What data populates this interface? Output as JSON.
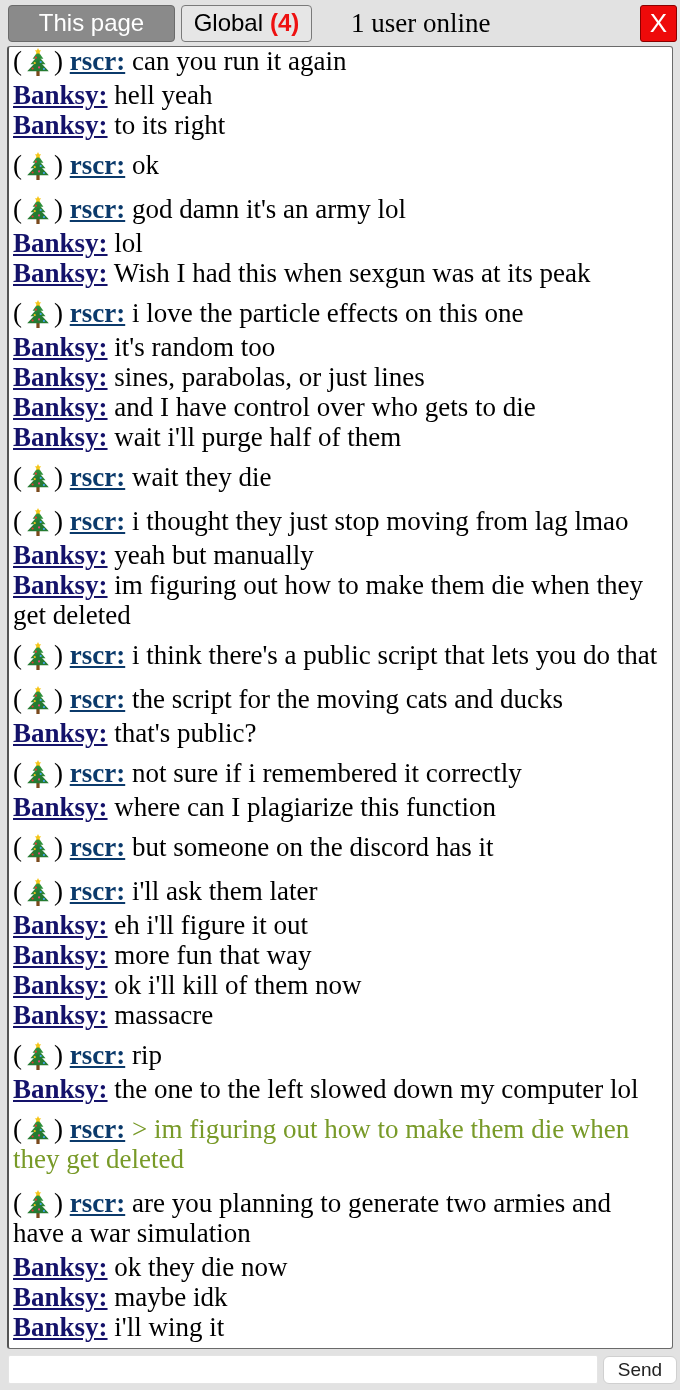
{
  "tabs": [
    {
      "label": "This page",
      "selected": true
    },
    {
      "label": "Global",
      "count": "(4)",
      "selected": false
    }
  ],
  "online_status": "1 user online",
  "close_button": "X",
  "messages": [
    {
      "badge": {
        "open": "(",
        "close": ")"
      },
      "user": "rscr:",
      "color": "#0b3a6b",
      "kind": "text",
      "text": "can you run it again"
    },
    {
      "user": "Banksy:",
      "color": "#14126a",
      "kind": "text",
      "text": "hell yeah"
    },
    {
      "user": "Banksy:",
      "color": "#14126a",
      "kind": "text",
      "text": "to its right"
    },
    {
      "badge": {
        "open": "(",
        "close": ")"
      },
      "user": "rscr:",
      "color": "#0b3a6b",
      "kind": "text",
      "text": "ok"
    },
    {
      "badge": {
        "open": "(",
        "close": ")"
      },
      "user": "rscr:",
      "color": "#0b3a6b",
      "kind": "text",
      "text": "god damn it's an army lol"
    },
    {
      "user": "Banksy:",
      "color": "#14126a",
      "kind": "text",
      "text": "lol"
    },
    {
      "user": "Banksy:",
      "color": "#14126a",
      "kind": "text",
      "text": "Wish I had this when sexgun was at its peak"
    },
    {
      "badge": {
        "open": "(",
        "close": ")"
      },
      "user": "rscr:",
      "color": "#0b3a6b",
      "kind": "text",
      "text": "i love the particle effects on this one"
    },
    {
      "user": "Banksy:",
      "color": "#14126a",
      "kind": "text",
      "text": "it's random too"
    },
    {
      "user": "Banksy:",
      "color": "#14126a",
      "kind": "text",
      "text": "sines, parabolas, or just lines"
    },
    {
      "user": "Banksy:",
      "color": "#14126a",
      "kind": "text",
      "text": "and I have control over who gets to die"
    },
    {
      "user": "Banksy:",
      "color": "#14126a",
      "kind": "text",
      "text": "wait i'll purge half of them"
    },
    {
      "badge": {
        "open": "(",
        "close": ")"
      },
      "user": "rscr:",
      "color": "#0b3a6b",
      "kind": "text",
      "text": "wait they die"
    },
    {
      "badge": {
        "open": "(",
        "close": ")"
      },
      "user": "rscr:",
      "color": "#0b3a6b",
      "kind": "text",
      "text": "i thought they just stop moving from lag lmao"
    },
    {
      "user": "Banksy:",
      "color": "#14126a",
      "kind": "text",
      "text": "yeah but manually"
    },
    {
      "user": "Banksy:",
      "color": "#14126a",
      "kind": "text",
      "text": "im figuring out how to make them die when they get deleted"
    },
    {
      "badge": {
        "open": "(",
        "close": ")"
      },
      "user": "rscr:",
      "color": "#0b3a6b",
      "kind": "text",
      "text": "i think there's a public script that lets you do that"
    },
    {
      "badge": {
        "open": "(",
        "close": ")"
      },
      "user": "rscr:",
      "color": "#0b3a6b",
      "kind": "text",
      "text": "the script for the moving cats and ducks"
    },
    {
      "user": "Banksy:",
      "color": "#14126a",
      "kind": "text",
      "text": "that's public?"
    },
    {
      "badge": {
        "open": "(",
        "close": ")"
      },
      "user": "rscr:",
      "color": "#0b3a6b",
      "kind": "text",
      "text": "not sure if i remembered it correctly"
    },
    {
      "user": "Banksy:",
      "color": "#14126a",
      "kind": "text",
      "text": "where can I plagiarize this function"
    },
    {
      "badge": {
        "open": "(",
        "close": ")"
      },
      "user": "rscr:",
      "color": "#0b3a6b",
      "kind": "text",
      "text": "but someone on the discord has it"
    },
    {
      "badge": {
        "open": "(",
        "close": ")"
      },
      "user": "rscr:",
      "color": "#0b3a6b",
      "kind": "text",
      "text": "i'll ask them later"
    },
    {
      "user": "Banksy:",
      "color": "#14126a",
      "kind": "text",
      "text": "eh i'll figure it out"
    },
    {
      "user": "Banksy:",
      "color": "#14126a",
      "kind": "text",
      "text": "more fun that way"
    },
    {
      "user": "Banksy:",
      "color": "#14126a",
      "kind": "text",
      "text": "ok i'll kill of them now"
    },
    {
      "user": "Banksy:",
      "color": "#14126a",
      "kind": "text",
      "text": "massacre"
    },
    {
      "badge": {
        "open": "(",
        "close": ")"
      },
      "user": "rscr:",
      "color": "#0b3a6b",
      "kind": "text",
      "text": "rip"
    },
    {
      "user": "Banksy:",
      "color": "#14126a",
      "kind": "text",
      "text": "the one to the left slowed down my computer lol"
    },
    {
      "badge": {
        "open": "(",
        "close": ")"
      },
      "user": "rscr:",
      "color": "#0b3a6b",
      "kind": "quote",
      "text": "> im figuring out how to make them die when they get deleted"
    },
    {
      "badge": {
        "open": "(",
        "close": ")"
      },
      "user": "rscr:",
      "color": "#0b3a6b",
      "kind": "text",
      "text": "are you planning to generate two armies and have a war simulation"
    },
    {
      "user": "Banksy:",
      "color": "#14126a",
      "kind": "text",
      "text": "ok they die now"
    },
    {
      "user": "Banksy:",
      "color": "#14126a",
      "kind": "text",
      "text": "maybe idk"
    },
    {
      "user": "Banksy:",
      "color": "#14126a",
      "kind": "text",
      "text": "i'll wing it"
    }
  ],
  "composer": {
    "send_button": "Send"
  }
}
